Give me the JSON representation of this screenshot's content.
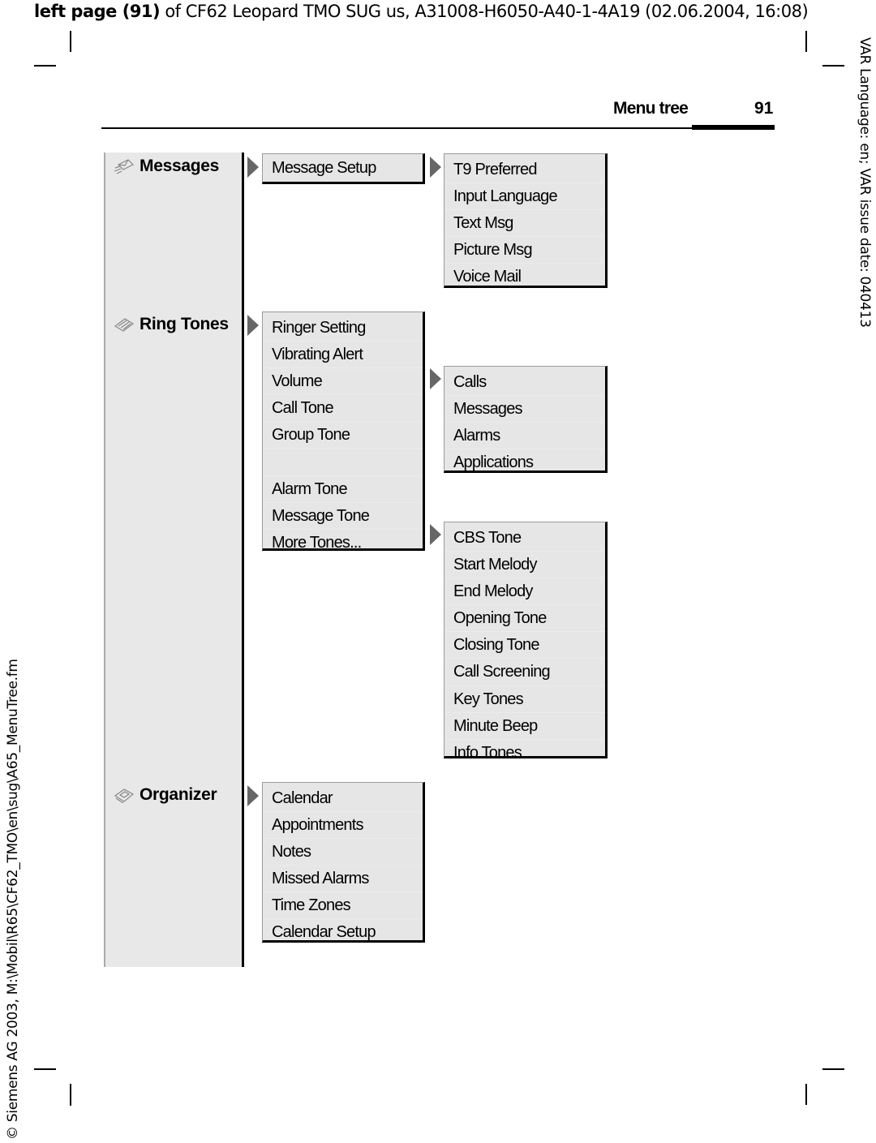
{
  "header": {
    "bold": "left page (91)",
    "rest": " of CF62 Leopard TMO SUG us, A31008-H6050-A40-1-4A19 (02.06.2004, 16:08)"
  },
  "side_right": "VAR Language: en; VAR issue date: 040413",
  "side_left": "© Siemens AG 2003, M:\\Mobil\\R65\\CF62_TMO\\en\\sug\\A65_MenuTree.fm",
  "page": {
    "title": "Menu tree",
    "number": "91"
  },
  "menu": {
    "messages": {
      "label": "Messages",
      "icon": "envelope-icon",
      "level2": [
        "Message Setup"
      ],
      "level3": [
        "T9 Preferred",
        "Input Language",
        "Text Msg",
        "Picture Msg",
        "Voice Mail"
      ]
    },
    "ring_tones": {
      "label": "Ring Tones",
      "icon": "ring-tones-icon",
      "level2": [
        "Ringer Setting",
        "Vibrating Alert",
        "Volume",
        "Call Tone",
        "Group Tone",
        "",
        "Alarm Tone",
        "Message Tone",
        "More Tones..."
      ],
      "volume_sub": [
        "Calls",
        "Messages",
        "Alarms",
        "Applications"
      ],
      "more_tones_sub": [
        "CBS Tone",
        "Start Melody",
        "End Melody",
        "Opening Tone",
        "Closing Tone",
        "Call Screening",
        "Key Tones",
        "Minute Beep",
        "Info Tones"
      ]
    },
    "organizer": {
      "label": "Organizer",
      "icon": "organizer-icon",
      "level2": [
        "Calendar",
        "Appointments",
        "Notes",
        "Missed Alarms",
        "Time Zones",
        "Calendar Setup"
      ]
    }
  }
}
